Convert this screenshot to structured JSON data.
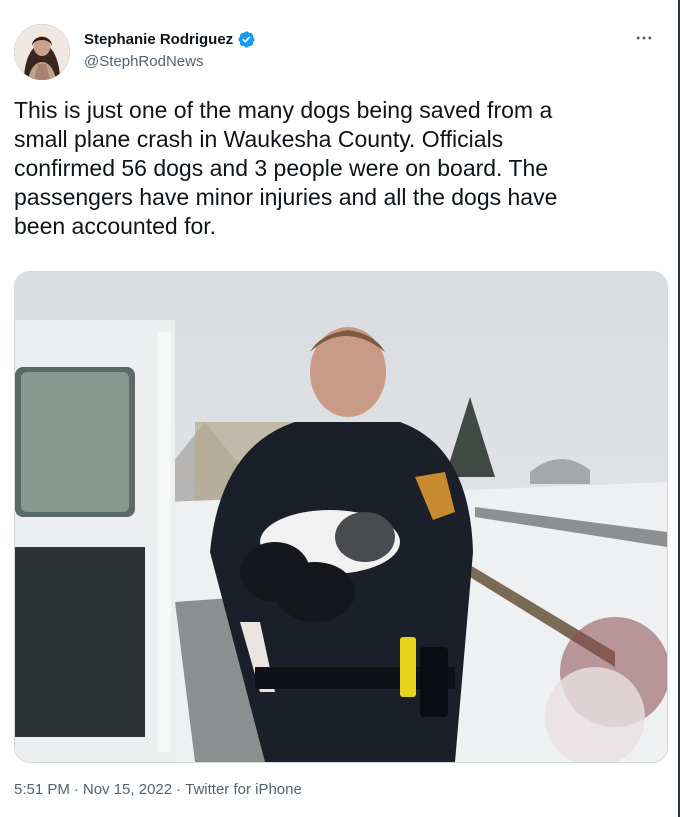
{
  "author": {
    "display_name": "Stephanie Rodriguez",
    "handle": "@StephRodNews",
    "verified_icon": "verified-badge-icon",
    "verified_color": "#1d9bf0"
  },
  "tweet": {
    "text": "This is just one of the many dogs being saved from a\nsmall plane crash in Waukesha County. Officials\nconfirmed 56 dogs and 3 people were on board. The\npassengers have minor injuries and all the dogs have\nbeen accounted for."
  },
  "meta": {
    "time": "5:51 PM",
    "separator1": "·",
    "date": "Nov 15, 2022",
    "separator2": "·",
    "source": "Twitter for iPhone"
  },
  "icons": {
    "more": "more-options-icon"
  },
  "colors": {
    "text": "#0f1419",
    "secondary": "#536471",
    "accent": "#1d9bf0"
  }
}
